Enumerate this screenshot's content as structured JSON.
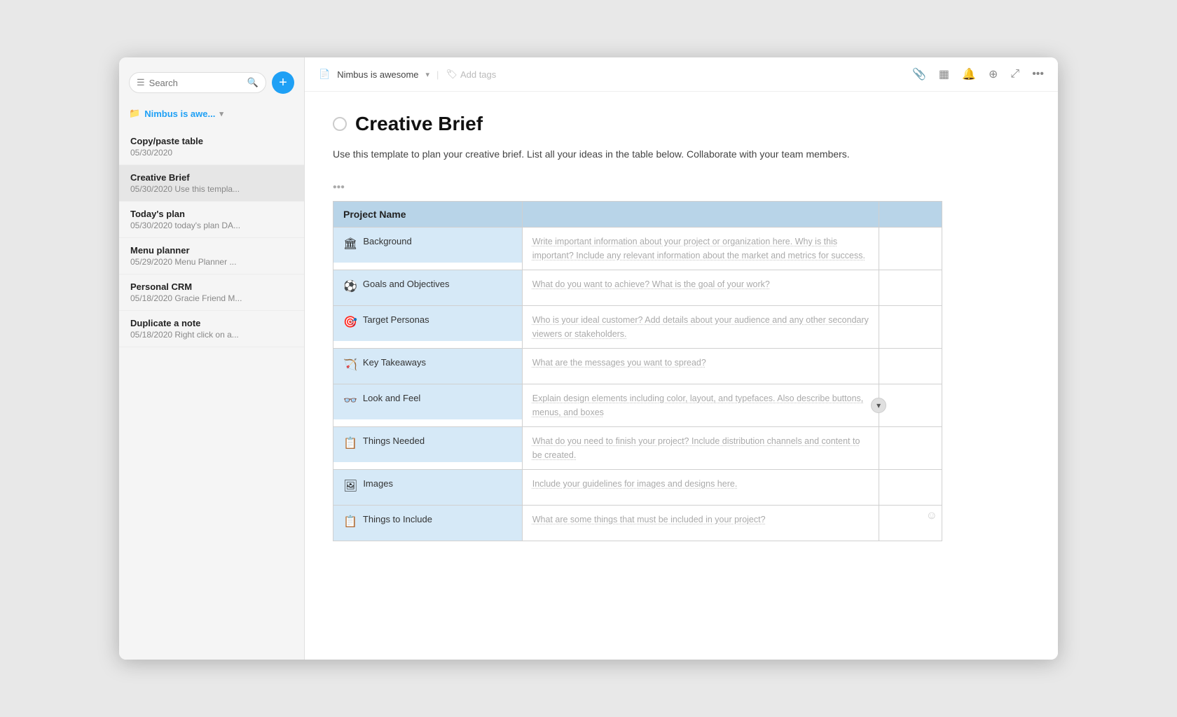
{
  "sidebar": {
    "search_placeholder": "Search",
    "workspace_name": "Nimbus is awe...",
    "add_button_label": "+",
    "items": [
      {
        "title": "Copy/paste table",
        "sub": "05/30/2020",
        "active": false
      },
      {
        "title": "Creative Brief",
        "sub": "05/30/2020 Use this templa...",
        "active": true
      },
      {
        "title": "Today's plan",
        "sub": "05/30/2020 today's plan DA...",
        "active": false
      },
      {
        "title": "Menu planner",
        "sub": "05/29/2020 Menu Planner ...",
        "active": false
      },
      {
        "title": "Personal CRM",
        "sub": "05/18/2020 Gracie Friend M...",
        "active": false
      },
      {
        "title": "Duplicate a note",
        "sub": "05/18/2020 Right click on a...",
        "active": false
      }
    ]
  },
  "topbar": {
    "breadcrumb": "Nimbus is awesome",
    "add_tag_label": "Add tags",
    "icons": [
      "paperclip",
      "grid",
      "bell",
      "share",
      "expand",
      "more"
    ]
  },
  "doc": {
    "title": "Creative Brief",
    "description": "Use this template to plan your creative brief. List all your ideas in the table below. Collaborate with your team members.",
    "table": {
      "header": {
        "col1": "Project Name",
        "col2": "",
        "col3": ""
      },
      "rows": [
        {
          "icon": "🏛",
          "label": "Background",
          "content": "Write important information about your project or organization here. Why is this important? Include any relevant information about the market and metrics for success."
        },
        {
          "icon": "⚽",
          "label": "Goals and Objectives",
          "content": "What do you want to achieve? What is the goal of your work?"
        },
        {
          "icon": "🎯",
          "label": "Target Personas",
          "content": "Who is your ideal customer? Add details about your audience and any other secondary viewers or stakeholders."
        },
        {
          "icon": "🏹",
          "label": "Key Takeaways",
          "content": "What are the messages you want to spread?"
        },
        {
          "icon": "👓",
          "label": "Look and Feel",
          "content": "Explain design elements including color, layout, and typefaces. Also describe buttons, menus, and boxes"
        },
        {
          "icon": "📋",
          "label": "Things Needed",
          "content": "What do you need to finish your project? Include distribution channels and content to be created."
        },
        {
          "icon": "🖼",
          "label": "Images",
          "content": "Include your guidelines for images and designs here."
        },
        {
          "icon": "📋",
          "label": "Things to Include",
          "content": "What are some things that must be included in your project?"
        }
      ]
    }
  }
}
